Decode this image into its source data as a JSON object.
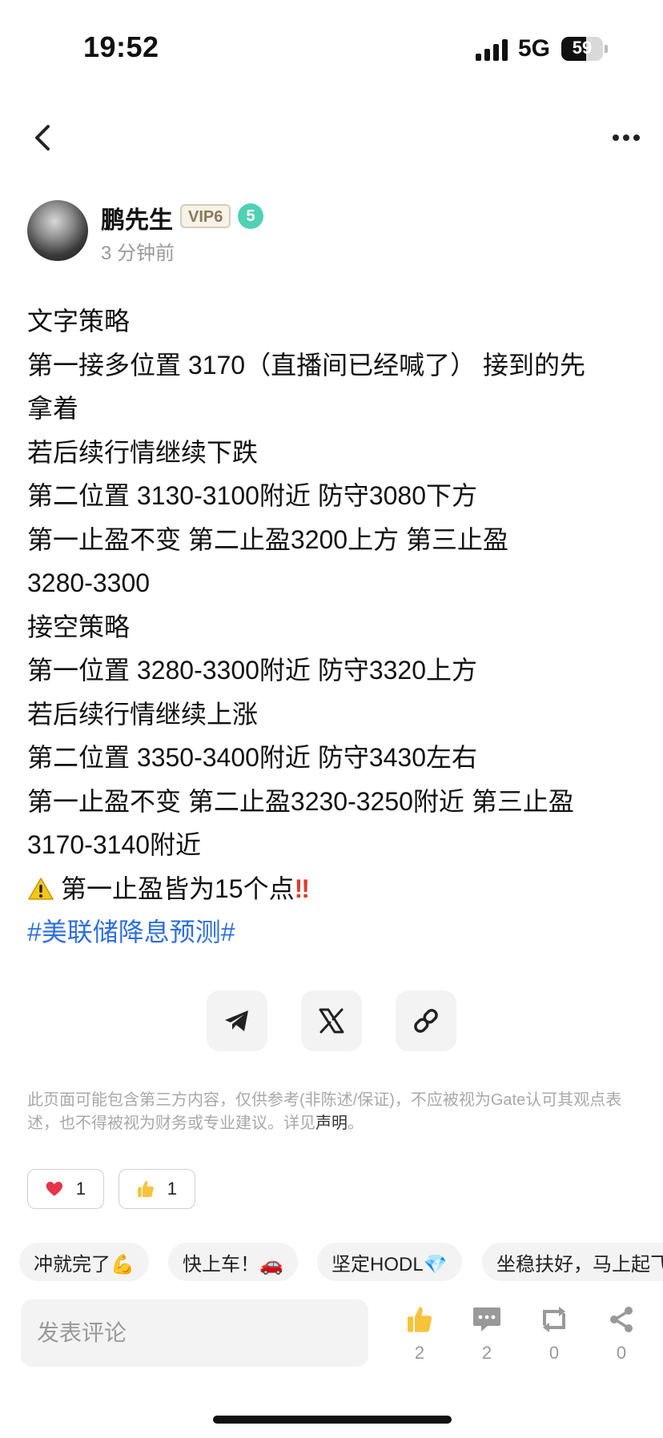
{
  "status_bar": {
    "time": "19:52",
    "network": "5G",
    "battery": "59"
  },
  "nav": {
    "back_icon": "chevron-left-icon",
    "more_icon": "more-dots-icon"
  },
  "author": {
    "name": "鹏先生",
    "vip_badge": "VIP6",
    "level": "5",
    "posted_ago": "3 分钟前"
  },
  "post": {
    "lines": [
      "文字策略",
      "第一接多位置 3170（直播间已经喊了） 接到的先",
      "拿着",
      "若后续行情继续下跌",
      "第二位置 3130-3100附近 防守3080下方",
      "第一止盈不变 第二止盈3200上方 第三止盈",
      "3280-3300",
      "接空策略",
      "第一位置 3280-3300附近 防守3320上方",
      "若后续行情继续上涨",
      "第二位置 3350-3400附近 防守3430左右",
      "第一止盈不变 第二止盈3230-3250附近 第三止盈",
      "3170-3140附近"
    ],
    "warning_text": "第一止盈皆为15个点",
    "warning_mark": "‼",
    "hashtag": "#美联储降息预测#"
  },
  "share": {
    "items": [
      "telegram-icon",
      "x-icon",
      "link-icon"
    ]
  },
  "disclaimer": {
    "text": "此页面可能包含第三方内容，仅供参考(非陈述/保证)，不应被视为Gate认可其观点表述，也不得被视为财务或专业建议。详见",
    "link": "声明",
    "end": "。"
  },
  "reactions": {
    "heart_count": "1",
    "thumb_count": "1"
  },
  "quick_replies": [
    "冲就完了💪",
    "快上车！🚗",
    "坚定HODL💎",
    "坐稳扶好，马上起飞"
  ],
  "comment_bar": {
    "placeholder": "发表评论",
    "like_count": "2",
    "comment_count": "2",
    "repost_count": "0",
    "share_count": "0"
  },
  "colors": {
    "hashtag": "#2f6fdf",
    "level_badge": "#4fd1b4",
    "warning_red": "#e03b2e"
  }
}
